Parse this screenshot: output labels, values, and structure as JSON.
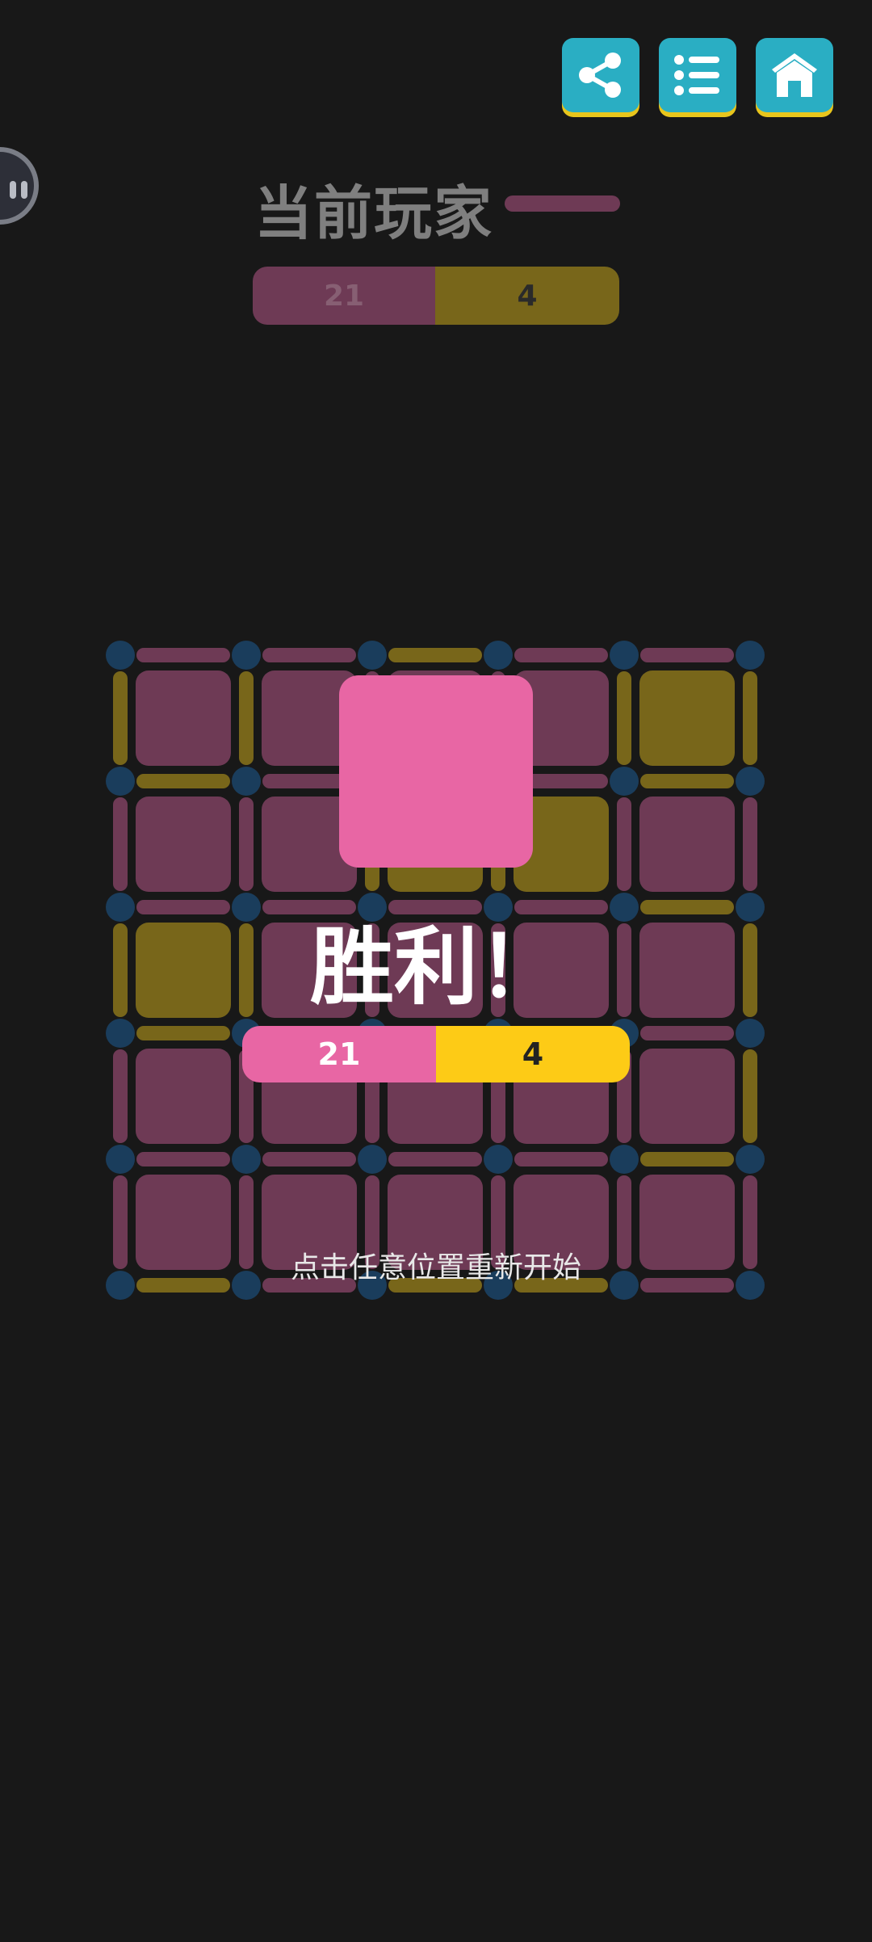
{
  "toolbar": {
    "share_icon": "share-icon",
    "list_icon": "list-icon",
    "home_icon": "home-icon",
    "button_color": "#2aaec3",
    "button_shadow": "#e8c51c"
  },
  "header": {
    "current_player_label": "当前玩家",
    "current_player_color": "#6e3a55"
  },
  "score": {
    "player1": "21",
    "player2": "4"
  },
  "colors": {
    "player1": "#e866a4",
    "player2": "#fdcb16",
    "player1_dim": "#6e3a55",
    "player2_dim": "#78661a",
    "dot": "#1a3d5c"
  },
  "board": {
    "size": 5,
    "cells": [
      [
        1,
        1,
        1,
        1,
        2
      ],
      [
        1,
        1,
        2,
        2,
        1
      ],
      [
        2,
        1,
        1,
        1,
        1
      ],
      [
        1,
        1,
        1,
        1,
        1
      ],
      [
        1,
        1,
        1,
        1,
        1
      ]
    ],
    "h_lines": [
      [
        1,
        1,
        2,
        1,
        1
      ],
      [
        2,
        1,
        1,
        1,
        2
      ],
      [
        1,
        1,
        1,
        1,
        2
      ],
      [
        2,
        1,
        1,
        1,
        1
      ],
      [
        1,
        1,
        1,
        1,
        2
      ],
      [
        2,
        1,
        2,
        2,
        1
      ]
    ],
    "v_lines": [
      [
        2,
        2,
        1,
        1,
        2,
        2
      ],
      [
        1,
        1,
        2,
        2,
        1,
        1
      ],
      [
        2,
        2,
        1,
        1,
        1,
        2
      ],
      [
        1,
        1,
        1,
        1,
        1,
        2
      ],
      [
        1,
        1,
        1,
        1,
        1,
        1
      ]
    ]
  },
  "result": {
    "title": "胜利！",
    "restart_hint": "点击任意位置重新开始"
  }
}
